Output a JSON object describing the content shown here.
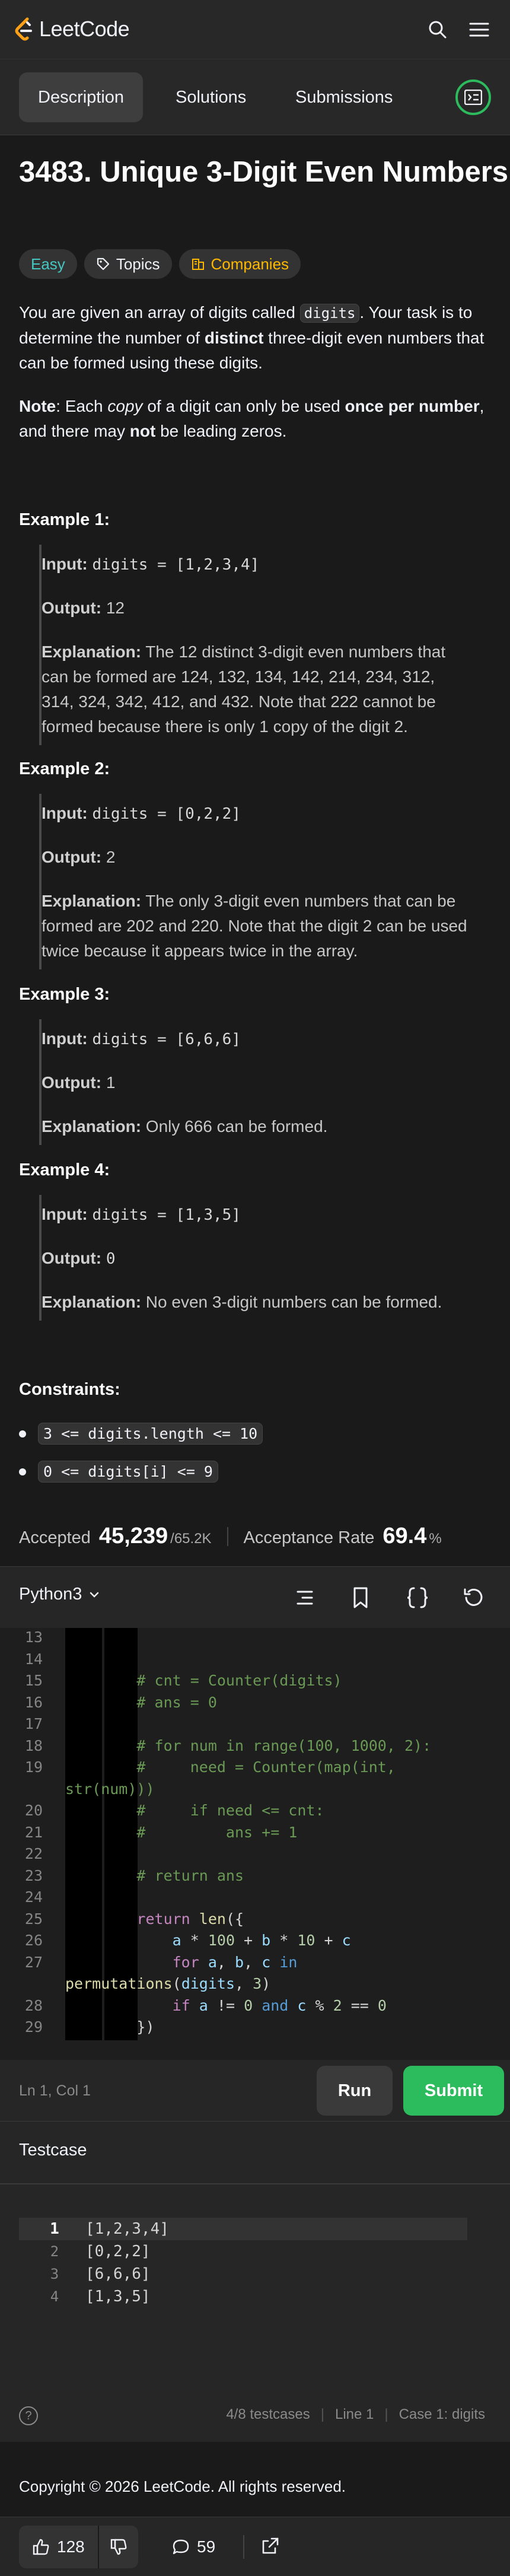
{
  "header": {
    "logo_text": "LeetCode",
    "icons": [
      "leetcode-logo-icon",
      "search-icon",
      "hamburger-menu-icon"
    ]
  },
  "tabs": [
    {
      "label": "Description",
      "active": true
    },
    {
      "label": "Solutions",
      "active": false
    },
    {
      "label": "Submissions",
      "active": false
    }
  ],
  "problem": {
    "title": "3483. Unique 3-Digit Even Numbers",
    "difficulty": "Easy",
    "topics_label": "Topics",
    "companies_label": "Companies",
    "intro_1": "You are given an array of digits called ",
    "intro_code": "digits",
    "intro_2": ". Your task is to determine the number of ",
    "intro_bold": "distinct",
    "intro_3": " three-digit even numbers that can be formed using these digits.",
    "note_label": "Note",
    "note_1": ": Each ",
    "note_italic": "copy",
    "note_2": " of a digit can only be used ",
    "note_bold1": "once per number",
    "note_3": ", and there may ",
    "note_bold2": "not",
    "note_4": " be leading zeros."
  },
  "examples": [
    {
      "title": "Example 1:",
      "input_label": "Input:",
      "input": "digits = [1,2,3,4]",
      "output_label": "Output:",
      "output": "12",
      "explanation_label": "Explanation:",
      "explanation_lines": [
        " The 12 distinct 3-digit even numbers that",
        "can be formed are 124, 132, 134, 142, 214, 234, 312,",
        "314, 324, 342, 412, and 432. Note that 222 cannot be",
        "formed because there is only 1 copy of the digit 2."
      ]
    },
    {
      "title": "Example 2:",
      "input_label": "Input:",
      "input": "digits = [0,2,2]",
      "output_label": "Output:",
      "output": "2",
      "explanation_label": "Explanation:",
      "explanation_lines": [
        " The only 3-digit even numbers that can be",
        "formed are 202 and 220. Note that the digit 2 can be used",
        "twice because it appears twice in the array."
      ]
    },
    {
      "title": "Example 3:",
      "input_label": "Input:",
      "input": "digits = [6,6,6]",
      "output_label": "Output:",
      "output": "1",
      "explanation_label": "Explanation:",
      "explanation_lines": [
        " Only 666 can be formed."
      ]
    },
    {
      "title": "Example 4:",
      "input_label": "Input:",
      "input": "digits = [1,3,5]",
      "output_label": "Output:",
      "output": "0",
      "explanation_label": "Explanation:",
      "explanation_lines": [
        " No even 3-digit numbers can be formed."
      ]
    }
  ],
  "constraints": {
    "title": "Constraints:",
    "items": [
      "3 <= digits.length <= 10",
      "0 <= digits[i] <= 9"
    ]
  },
  "stats": {
    "accepted_label": "Accepted",
    "accepted_value": "45,239",
    "accepted_total": "/65.2K",
    "rate_label": "Acceptance Rate",
    "rate_value": "69.4",
    "rate_unit": "%"
  },
  "editor": {
    "language": "Python3",
    "icons": [
      "format-icon",
      "bookmark-icon",
      "braces-icon",
      "reset-icon"
    ],
    "lines": [
      {
        "n": "13",
        "segs": []
      },
      {
        "n": "14",
        "segs": []
      },
      {
        "n": "15",
        "segs": [
          {
            "t": "        ",
            "c": ""
          },
          {
            "t": "# cnt = Counter(digits)",
            "c": "cm"
          }
        ]
      },
      {
        "n": "16",
        "segs": [
          {
            "t": "        ",
            "c": ""
          },
          {
            "t": "# ans = 0",
            "c": "cm"
          }
        ]
      },
      {
        "n": "17",
        "segs": []
      },
      {
        "n": "18",
        "segs": [
          {
            "t": "        ",
            "c": ""
          },
          {
            "t": "# for num in range(100, 1000, 2):",
            "c": "cm"
          }
        ]
      },
      {
        "n": "19",
        "segs": [
          {
            "t": "        ",
            "c": ""
          },
          {
            "t": "#     need = Counter(map(int,",
            "c": "cm"
          }
        ]
      },
      {
        "n": "",
        "segs": [
          {
            "t": "str(num)))",
            "c": "cm"
          }
        ]
      },
      {
        "n": "20",
        "segs": [
          {
            "t": "        ",
            "c": ""
          },
          {
            "t": "#     if need <= cnt:",
            "c": "cm"
          }
        ]
      },
      {
        "n": "21",
        "segs": [
          {
            "t": "        ",
            "c": ""
          },
          {
            "t": "#         ans += 1",
            "c": "cm"
          }
        ]
      },
      {
        "n": "22",
        "segs": []
      },
      {
        "n": "23",
        "segs": [
          {
            "t": "        ",
            "c": ""
          },
          {
            "t": "# return ans",
            "c": "cm"
          }
        ]
      },
      {
        "n": "24",
        "segs": []
      },
      {
        "n": "25",
        "segs": [
          {
            "t": "        ",
            "c": ""
          },
          {
            "t": "return",
            "c": "kw"
          },
          {
            "t": " ",
            "c": ""
          },
          {
            "t": "len",
            "c": "fn"
          },
          {
            "t": "({",
            "c": ""
          }
        ]
      },
      {
        "n": "26",
        "segs": [
          {
            "t": "            ",
            "c": ""
          },
          {
            "t": "a",
            "c": "vr"
          },
          {
            "t": " * ",
            "c": ""
          },
          {
            "t": "100",
            "c": "nm"
          },
          {
            "t": " + ",
            "c": ""
          },
          {
            "t": "b",
            "c": "vr"
          },
          {
            "t": " * ",
            "c": ""
          },
          {
            "t": "10",
            "c": "nm"
          },
          {
            "t": " + ",
            "c": ""
          },
          {
            "t": "c",
            "c": "vr"
          }
        ]
      },
      {
        "n": "27",
        "segs": [
          {
            "t": "            ",
            "c": ""
          },
          {
            "t": "for",
            "c": "kw"
          },
          {
            "t": " ",
            "c": ""
          },
          {
            "t": "a",
            "c": "vr"
          },
          {
            "t": ", ",
            "c": ""
          },
          {
            "t": "b",
            "c": "vr"
          },
          {
            "t": ", ",
            "c": ""
          },
          {
            "t": "c",
            "c": "vr"
          },
          {
            "t": " ",
            "c": ""
          },
          {
            "t": "in",
            "c": "bl"
          }
        ]
      },
      {
        "n": "",
        "segs": [
          {
            "t": "permutations",
            "c": "fn"
          },
          {
            "t": "(",
            "c": ""
          },
          {
            "t": "digits",
            "c": "vr"
          },
          {
            "t": ", ",
            "c": ""
          },
          {
            "t": "3",
            "c": "nm"
          },
          {
            "t": ")",
            "c": ""
          }
        ]
      },
      {
        "n": "28",
        "segs": [
          {
            "t": "            ",
            "c": ""
          },
          {
            "t": "if",
            "c": "kw"
          },
          {
            "t": " ",
            "c": ""
          },
          {
            "t": "a",
            "c": "vr"
          },
          {
            "t": " != ",
            "c": ""
          },
          {
            "t": "0",
            "c": "nm"
          },
          {
            "t": " ",
            "c": ""
          },
          {
            "t": "and",
            "c": "bl"
          },
          {
            "t": " ",
            "c": ""
          },
          {
            "t": "c",
            "c": "vr"
          },
          {
            "t": " % ",
            "c": ""
          },
          {
            "t": "2",
            "c": "nm"
          },
          {
            "t": " == ",
            "c": ""
          },
          {
            "t": "0",
            "c": "nm"
          }
        ]
      },
      {
        "n": "29",
        "segs": [
          {
            "t": "        ",
            "c": ""
          },
          {
            "t": "})",
            "c": ""
          }
        ]
      }
    ],
    "cursor_pos": "Ln 1, Col 1",
    "run_label": "Run",
    "submit_label": "Submit"
  },
  "testcase": {
    "title": "Testcase",
    "rows": [
      {
        "n": "1",
        "v": "[1,2,3,4]",
        "active": true
      },
      {
        "n": "2",
        "v": "[0,2,2]",
        "active": false
      },
      {
        "n": "3",
        "v": "[6,6,6]",
        "active": false
      },
      {
        "n": "4",
        "v": "[1,3,5]",
        "active": false
      }
    ],
    "status_testcases": "4/8 testcases",
    "status_line": "Line 1",
    "status_case": "Case 1: digits"
  },
  "footer": {
    "copyright": "Copyright © 2026 LeetCode. All rights reserved.",
    "likes": "128",
    "comments": "59"
  },
  "colors": {
    "accent_green": "#2cbb5d",
    "easy": "#46c6c2",
    "companies": "#ffb800",
    "background": "#1a1a1a"
  }
}
